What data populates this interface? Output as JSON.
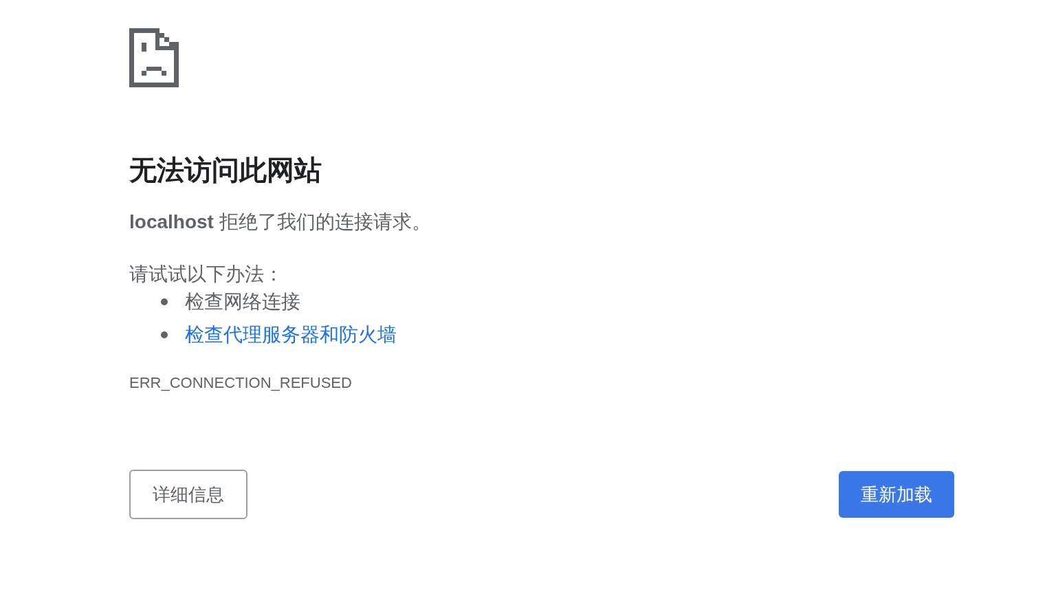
{
  "title": "无法访问此网站",
  "message": "**localhost** 拒绝了我们的连接请求。",
  "suggestions_heading": "请试试以下办法：",
  "suggestions": [
    {
      "text": "检查网络连接",
      "kind": "text"
    },
    {
      "text": "检查代理服务器和防火墙",
      "kind": "link"
    }
  ],
  "error_code": "ERR_CONNECTION_REFUSED",
  "buttons": [
    {
      "label": "详细信息",
      "kind": "secondary"
    },
    {
      "label": "重新加载",
      "kind": "primary"
    }
  ]
}
